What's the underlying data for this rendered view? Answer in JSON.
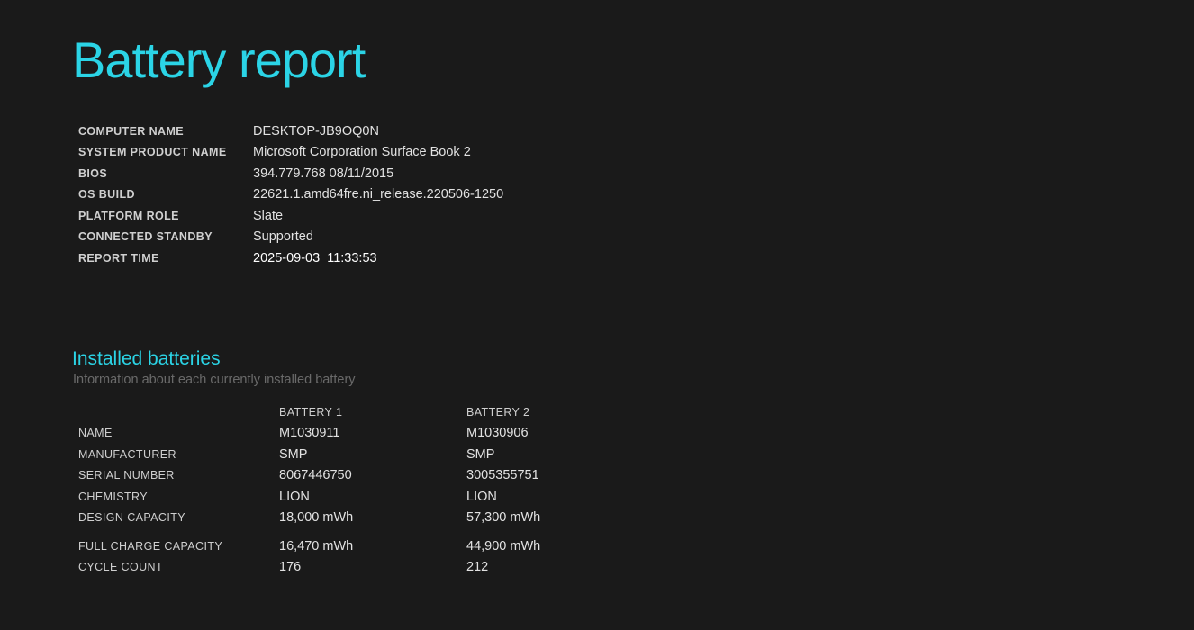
{
  "page": {
    "title": "Battery report"
  },
  "system_info": [
    {
      "label": "COMPUTER NAME",
      "value": "DESKTOP-JB9OQ0N"
    },
    {
      "label": "SYSTEM PRODUCT NAME",
      "value": "Microsoft Corporation Surface Book 2"
    },
    {
      "label": "BIOS",
      "value": "394.779.768 08/11/2015"
    },
    {
      "label": "OS BUILD",
      "value": "22621.1.amd64fre.ni_release.220506-1250"
    },
    {
      "label": "PLATFORM ROLE",
      "value": "Slate"
    },
    {
      "label": "CONNECTED STANDBY",
      "value": "Supported"
    },
    {
      "label": "REPORT TIME",
      "value": "2025-09-03  11:33:53"
    }
  ],
  "installed_batteries": {
    "title": "Installed batteries",
    "subtitle": "Information about each currently installed battery",
    "headers": [
      "BATTERY 1",
      "BATTERY 2"
    ],
    "rows": [
      {
        "label": "NAME",
        "b1": "M1030911",
        "b2": "M1030906"
      },
      {
        "label": "MANUFACTURER",
        "b1": "SMP",
        "b2": "SMP"
      },
      {
        "label": "SERIAL NUMBER",
        "b1": "8067446750",
        "b2": "3005355751"
      },
      {
        "label": "CHEMISTRY",
        "b1": "LION",
        "b2": "LION"
      },
      {
        "label": "DESIGN CAPACITY",
        "b1": "18,000 mWh",
        "b2": "57,300 mWh"
      },
      {
        "label": "FULL CHARGE CAPACITY",
        "b1": "16,470 mWh",
        "b2": "44,900 mWh"
      },
      {
        "label": "CYCLE COUNT",
        "b1": "176",
        "b2": "212"
      }
    ]
  },
  "colors": {
    "background": "#1a1a1a",
    "accent": "#2bd4e6",
    "subtitle": "#6a6a6a"
  }
}
